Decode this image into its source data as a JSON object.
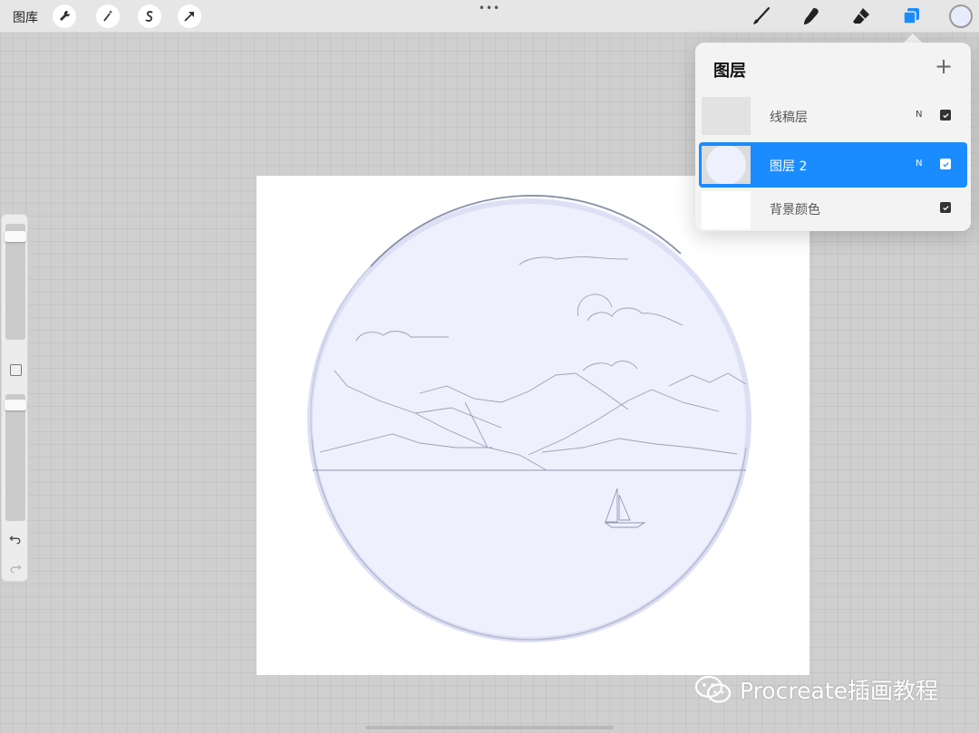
{
  "toolbar": {
    "gallery_label": "图库",
    "more_label": "•••",
    "left_tools": [
      {
        "icon": "wrench-icon"
      },
      {
        "icon": "magic-wand-icon"
      },
      {
        "icon": "selection-icon"
      },
      {
        "icon": "transform-arrow-icon"
      }
    ],
    "right_tools": [
      {
        "icon": "brush-icon"
      },
      {
        "icon": "smudge-icon"
      },
      {
        "icon": "eraser-icon"
      },
      {
        "icon": "layers-icon",
        "active": true
      }
    ],
    "current_color": "#e8ebfb",
    "accent_color": "#1a8cff"
  },
  "sidebar": {
    "brush_size_level": 0.93,
    "opacity_level": 0.95
  },
  "layers_panel": {
    "title": "图层",
    "add_label": "+",
    "layers": [
      {
        "name": "线稿层",
        "blend": "N",
        "visible": true,
        "selected": false
      },
      {
        "name": "图层 2",
        "blend": "N",
        "visible": true,
        "selected": true
      },
      {
        "name": "背景颜色",
        "blend": "",
        "visible": true,
        "selected": false
      }
    ]
  },
  "watermark": {
    "text": "Procreate插画教程"
  }
}
